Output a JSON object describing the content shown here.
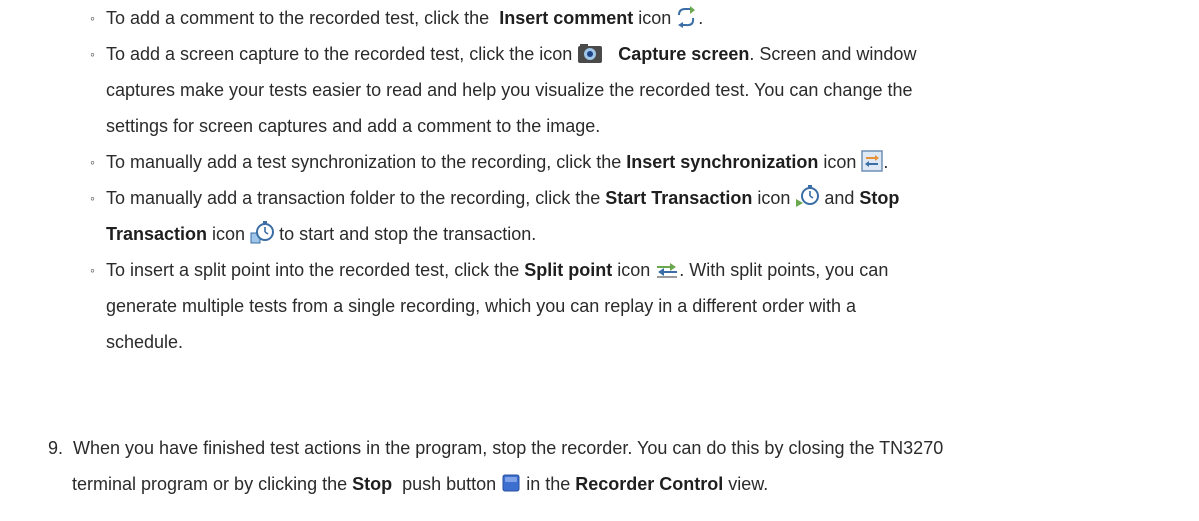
{
  "items": [
    {
      "pre": "To add a comment to the recorded test, click the  ",
      "bold": "Insert comment",
      "post": " icon ",
      "end": "."
    },
    {
      "pre": "To add a screen capture to the recorded test, click the icon ",
      "bold": "Capture screen",
      "post1": ". Screen and window",
      "line2": "captures make your tests easier to read and help you visualize the recorded test. You can change the",
      "line3": "settings for screen captures and add a comment to the image."
    },
    {
      "pre": "To manually add a test synchronization to the recording, click the ",
      "bold": "Insert synchronization",
      "post": " icon ",
      "end": "."
    },
    {
      "pre": "To manually add a transaction folder to the recording, click the ",
      "bold1": "Start Transaction",
      "mid1": " icon ",
      "mid2": " and ",
      "bold2a": "Stop",
      "bold2b": "Transaction",
      "mid3": " icon ",
      "end": " to start and stop the transaction."
    },
    {
      "pre": "To insert a split point into the recorded test, click the ",
      "bold": "Split point",
      "post": " icon ",
      "post2": ". With split points, you can",
      "line2": "generate multiple tests from a single recording, which you can replay in a different order with a",
      "line3": "schedule."
    }
  ],
  "step9": {
    "num": "9.",
    "text1": "When you have finished test actions in the program, stop the recorder. You can do this by closing the TN3270",
    "text2_pre": "terminal program or by clicking the ",
    "bold1": "Stop",
    "text2_mid": "  push button ",
    "text2_mid2": " in the ",
    "bold2": "Recorder Control",
    "text2_end": " view."
  },
  "icons": [
    "insert-comment-icon",
    "capture-screen-icon",
    "insert-synchronization-icon",
    "start-transaction-icon",
    "stop-transaction-icon",
    "split-point-icon",
    "stop-button-icon"
  ]
}
